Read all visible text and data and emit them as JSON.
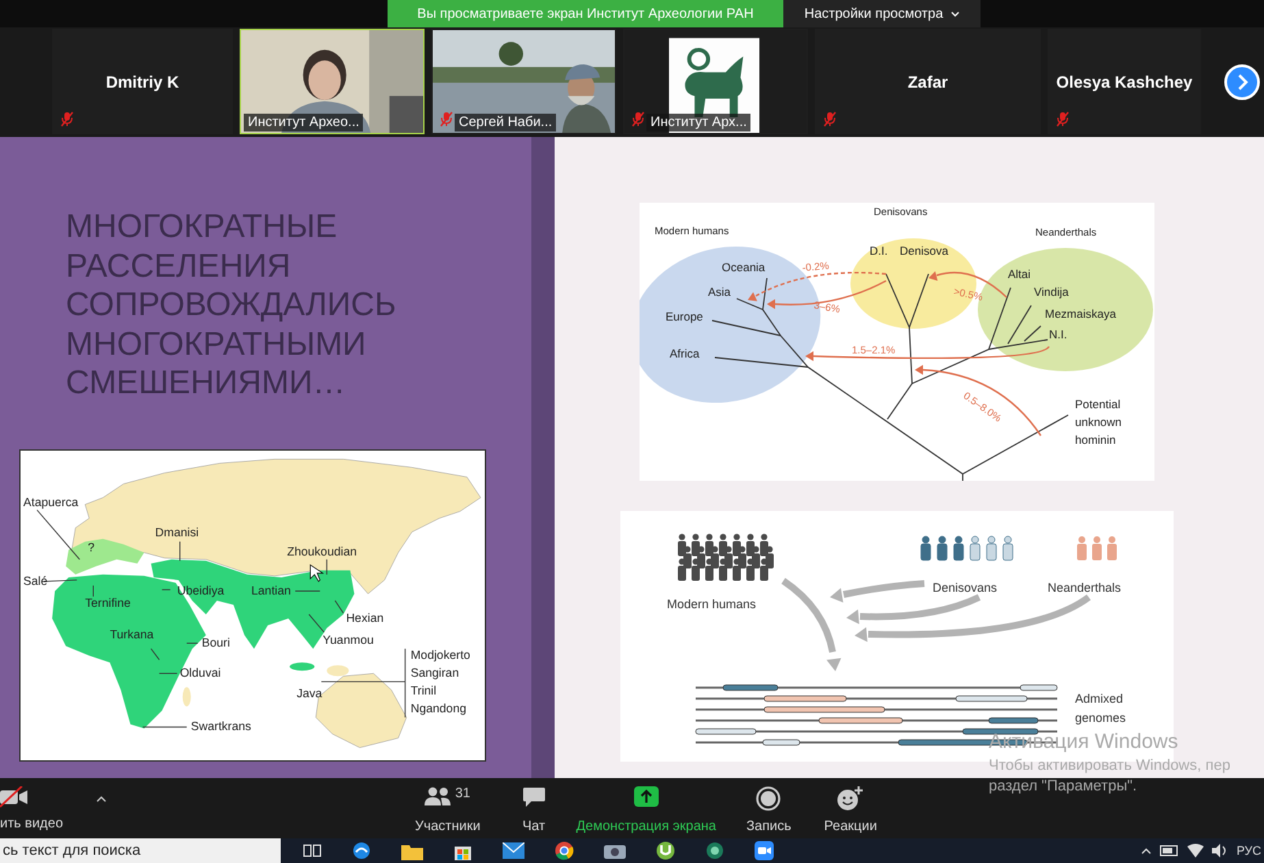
{
  "share_banner": {
    "text": "Вы просматриваете экран Институт Археологии РАН",
    "settings_button": "Настройки просмотра"
  },
  "participants": [
    {
      "kind": "name",
      "name": "Dmitriy K",
      "muted": true,
      "speaking": false
    },
    {
      "kind": "video",
      "name": "Институт Археo...",
      "muted": false,
      "speaking": true
    },
    {
      "kind": "video",
      "name": "Сергей Наби...",
      "muted": true,
      "speaking": false
    },
    {
      "kind": "video",
      "name": "Институт Арх...",
      "muted": true,
      "speaking": false
    },
    {
      "kind": "name",
      "name": "Zafar",
      "muted": true,
      "speaking": false
    },
    {
      "kind": "name",
      "name": "Olesya Kashchey",
      "muted": true,
      "speaking": false
    }
  ],
  "slide_left": {
    "title": "МНОГОКРАТНЫЕ РАССЕЛЕНИЯ СОПРОВОЖДАЛИСЬ МНОГОКРАТНЫМИ СМЕШЕНИЯМИ…",
    "map_labels": [
      "Atapuerca",
      "?",
      "Dmanisi",
      "Zhoukoudian",
      "Salé",
      "Ubeidiya",
      "Lantian",
      "Ternifine",
      "Hexian",
      "Turkana",
      "Bouri",
      "Yuanmou",
      "Olduvai",
      "Java",
      "Modjokerto",
      "Sangiran",
      "Trinil",
      "Ngandong",
      "Swartkrans"
    ]
  },
  "slide_right": {
    "tree_labels": [
      "Modern humans",
      "Denisovans",
      "Neanderthals",
      "Oceania",
      "Asia",
      "Europe",
      "Africa",
      "D.I.",
      "Denisova",
      "Altai",
      "Vindija",
      "Mezmaiskaya",
      "N.I.",
      "Potential unknown hominin"
    ],
    "flow_labels": [
      "-0.2%",
      "3–6%",
      ">0.5%",
      "1.5–2.1%",
      "0.5–8.0%"
    ],
    "admix_labels": [
      "Modern humans",
      "Denisovans",
      "Neanderthals",
      "Admixed genomes"
    ]
  },
  "toolbar": {
    "video_label": "ить видео",
    "items": [
      {
        "kind": "participants",
        "label": "Участники",
        "count": "31"
      },
      {
        "kind": "chat",
        "label": "Чат"
      },
      {
        "kind": "share",
        "label": "Демонстрация экрана"
      },
      {
        "kind": "record",
        "label": "Запись"
      },
      {
        "kind": "reactions",
        "label": "Реакции"
      }
    ]
  },
  "windows_activation": {
    "title": "Активация Windows",
    "line1": "Чтобы активировать Windows, пер",
    "line2": "раздел \"Параметры\"."
  },
  "taskbar": {
    "search_placeholder": "сь текст для поиска",
    "language": "РУС"
  }
}
